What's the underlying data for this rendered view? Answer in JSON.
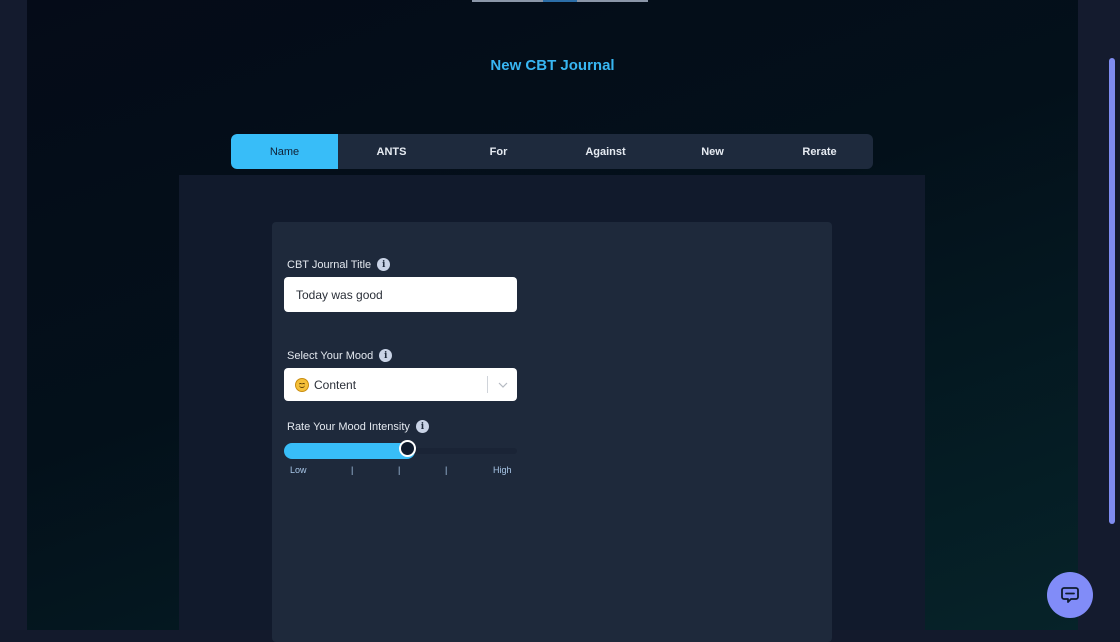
{
  "header": {
    "title": "New CBT Journal"
  },
  "tabs": [
    {
      "label": "Name",
      "active": true
    },
    {
      "label": "ANTS",
      "active": false
    },
    {
      "label": "For",
      "active": false
    },
    {
      "label": "Against",
      "active": false
    },
    {
      "label": "New",
      "active": false
    },
    {
      "label": "Rerate",
      "active": false
    }
  ],
  "form": {
    "title_label": "CBT Journal Title",
    "title_value": "Today was good",
    "mood_label": "Select Your Mood",
    "mood_value": "Content",
    "mood_icon": "smiling-face-icon",
    "intensity_label": "Rate Your Mood Intensity",
    "intensity_fraction": 0.53,
    "intensity_low_label": "Low",
    "intensity_high_label": "High",
    "intensity_marks": [
      "|",
      "|",
      "|"
    ]
  },
  "icons": {
    "info": "info-icon",
    "chevron": "chevron-down-icon",
    "chat": "chat-icon"
  },
  "colors": {
    "accent": "#38bdf8",
    "title": "#38b6f2",
    "chat_button": "#818cf8",
    "card": "#1e293b"
  }
}
